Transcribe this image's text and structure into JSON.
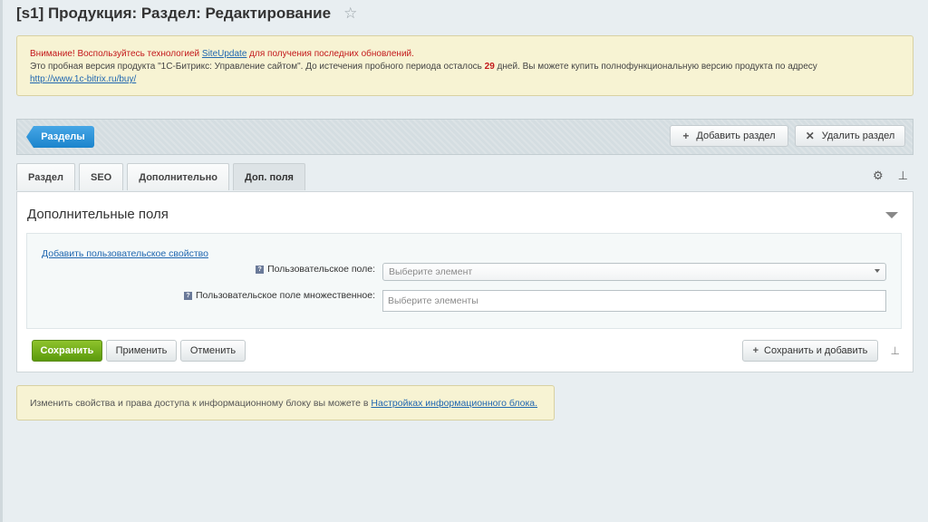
{
  "page": {
    "title": "[s1] Продукция: Раздел: Редактирование",
    "star_glyph": "☆"
  },
  "notice": {
    "warning_prefix": "Внимание! Воспользуйтесь технологией",
    "warning_link": "SiteUpdate",
    "warning_suffix": "для получения последних обновлений.",
    "trial_prefix": "Это пробная версия продукта \"1С-Битрикс: Управление сайтом\". До истечения пробного периода осталось",
    "trial_days": "29",
    "trial_suffix": "дней. Вы можете купить полнофункциональную версию продукта по адресу",
    "buy_link": "http://www.1c-bitrix.ru/buy/"
  },
  "toolbar": {
    "sections_label": "Разделы",
    "add_section_label": "Добавить раздел",
    "delete_section_label": "Удалить раздел",
    "add_icon": "+",
    "delete_icon": "✕"
  },
  "tabs": [
    {
      "label": "Раздел",
      "active": false
    },
    {
      "label": "SEO",
      "active": false
    },
    {
      "label": "Дополнительно",
      "active": false
    },
    {
      "label": "Доп. поля",
      "active": true
    }
  ],
  "tab_tools": {
    "settings_glyph": "⚙",
    "pin_glyph": "⊥"
  },
  "panel": {
    "title": "Дополнительные поля",
    "add_property_link": "Добавить пользовательское свойство",
    "fields": [
      {
        "label": "Пользовательское поле:",
        "placeholder": "Выберите элемент",
        "type": "select"
      },
      {
        "label": "Пользовательское поле множественное:",
        "placeholder": "Выберите элементы",
        "type": "input"
      }
    ],
    "help_glyph": "?"
  },
  "buttons": {
    "save": "Сохранить",
    "apply": "Применить",
    "cancel": "Отменить",
    "save_add": "Сохранить и добавить",
    "save_add_icon": "+"
  },
  "info": {
    "text": "Изменить свойства и права доступа к информационному блоку вы можете в",
    "link": "Настройках информационного блока."
  },
  "colors": {
    "accent_blue": "#1b84cc",
    "save_green": "#6aab12",
    "notice_bg": "#f7f3d3",
    "warning_red": "#c3191b",
    "link_blue": "#2067b0"
  }
}
